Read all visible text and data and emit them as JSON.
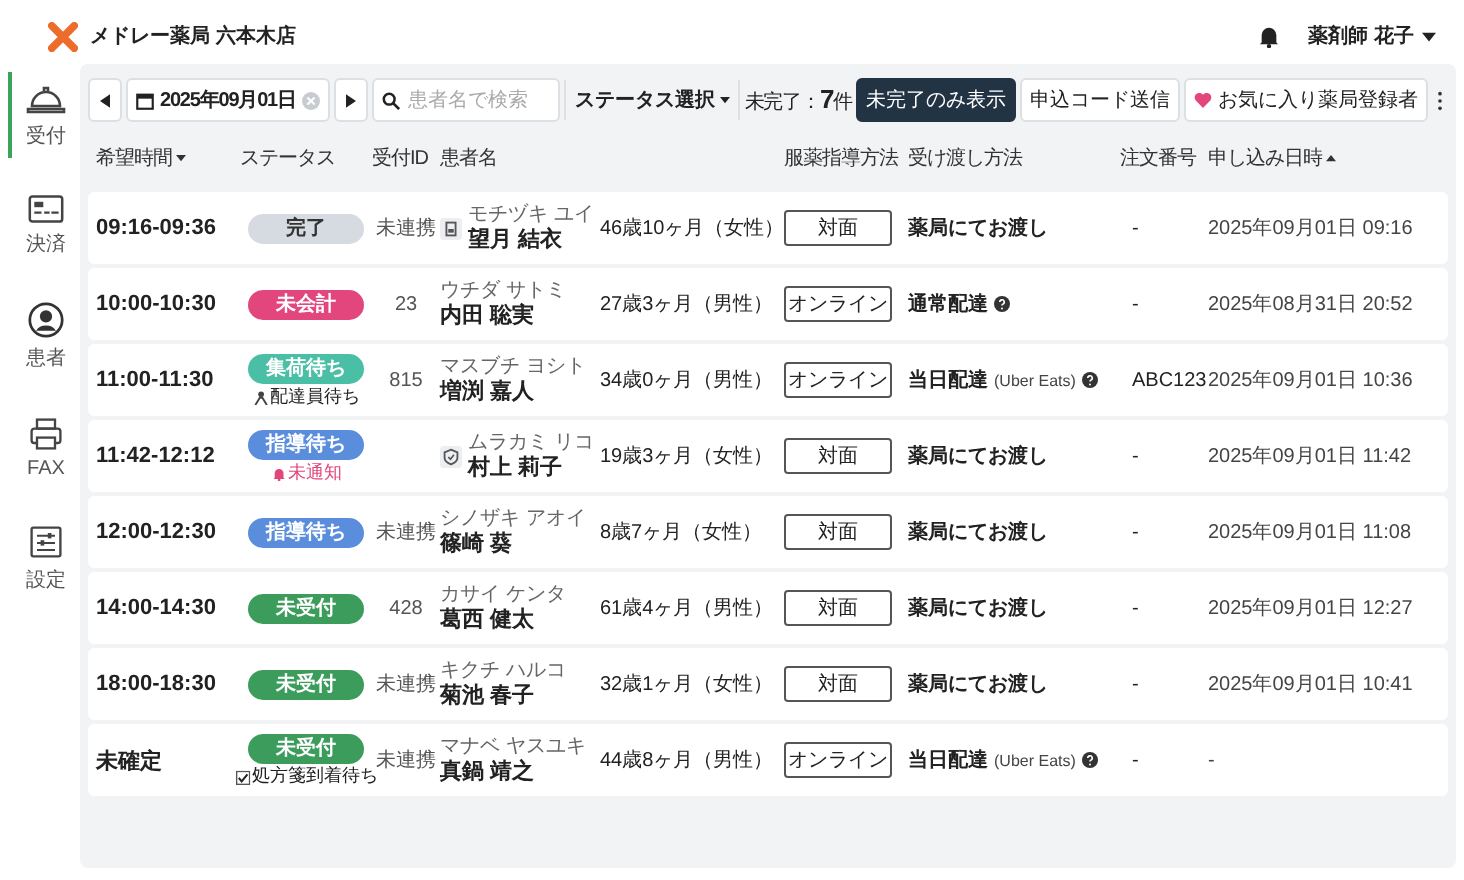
{
  "header": {
    "store_name": "メドレー薬局 六本木店",
    "user_name": "薬剤師 花子"
  },
  "sidebar": {
    "items": [
      {
        "label": "受付",
        "selected": true
      },
      {
        "label": "決済",
        "selected": false
      },
      {
        "label": "患者",
        "selected": false
      },
      {
        "label": "FAX",
        "selected": false
      },
      {
        "label": "設定",
        "selected": false
      }
    ]
  },
  "toolbar": {
    "date": "2025年09月01日",
    "search": {
      "placeholder": "患者名で検索"
    },
    "status_filter": "ステータス選択",
    "count_label": "未完了：",
    "count_value": "7",
    "count_unit": "件",
    "filter_button": "未完了のみ表示",
    "code_button": "申込コード送信",
    "favorite_button": "お気に入り薬局登録者"
  },
  "table": {
    "columns": [
      {
        "label": "希望時間",
        "sorted": true,
        "descending": true
      },
      {
        "label": "ステータス",
        "sorted": false
      },
      {
        "label": "受付ID",
        "sorted": false
      },
      {
        "label": "患者名",
        "sorted": false
      },
      {
        "label": "服薬指導方法",
        "sorted": false
      },
      {
        "label": "受け渡し方法",
        "sorted": false
      },
      {
        "label": "注文番号",
        "sorted": false
      },
      {
        "label": "申し込み日時",
        "sorted": true,
        "descending": false
      }
    ],
    "rows": [
      {
        "time": "09:16-09:36",
        "status": {
          "label": "完了",
          "kind": "done"
        },
        "reception_id": "未連携",
        "patient": {
          "kind": "card",
          "kana": "モチヅキ ユイ",
          "name": "望月 結衣",
          "age": "46歳10ヶ月（女性）"
        },
        "guidance": "対面",
        "delivery": {
          "method": "薬局にてお渡し"
        },
        "order_no": "-",
        "applied_at": "2025年09月01日 09:16"
      },
      {
        "time": "10:00-10:30",
        "status": {
          "label": "未会計",
          "kind": "unpaid"
        },
        "reception_id": "23",
        "patient": {
          "kana": "ウチダ サトミ",
          "name": "内田 聡実",
          "age": "27歳3ヶ月（男性）"
        },
        "guidance": "オンライン",
        "delivery": {
          "method": "通常配達",
          "help": true
        },
        "order_no": "-",
        "applied_at": "2025年08月31日 20:52"
      },
      {
        "time": "11:00-11:30",
        "status": {
          "label": "集荷待ち",
          "kind": "pickup",
          "note": {
            "kind": "courier",
            "text": "配達員待ち"
          }
        },
        "reception_id": "815",
        "patient": {
          "kana": "マスブチ ヨシト",
          "name": "増渕 嘉人",
          "age": "34歳0ヶ月（男性）"
        },
        "guidance": "オンライン",
        "delivery": {
          "method": "当日配達",
          "detail": "(Uber Eats)",
          "help": true
        },
        "order_no": "ABC123",
        "applied_at": "2025年09月01日 10:36"
      },
      {
        "time": "11:42-12:12",
        "status": {
          "label": "指導待ち",
          "kind": "guidance",
          "note": {
            "kind": "alert",
            "text": "未通知"
          }
        },
        "patient": {
          "kind": "verified",
          "kana": "ムラカミ リコ",
          "name": "村上 莉子",
          "age": "19歳3ヶ月（女性）"
        },
        "guidance": "対面",
        "delivery": {
          "method": "薬局にてお渡し"
        },
        "order_no": "-",
        "applied_at": "2025年09月01日 11:42"
      },
      {
        "time": "12:00-12:30",
        "status": {
          "label": "指導待ち",
          "kind": "guidance"
        },
        "reception_id": "未連携",
        "patient": {
          "kana": "シノザキ アオイ",
          "name": "篠崎 葵",
          "age": "8歳7ヶ月（女性）"
        },
        "guidance": "対面",
        "delivery": {
          "method": "薬局にてお渡し"
        },
        "order_no": "-",
        "applied_at": "2025年09月01日 11:08"
      },
      {
        "time": "14:00-14:30",
        "status": {
          "label": "未受付",
          "kind": "unaccepted"
        },
        "reception_id": "428",
        "patient": {
          "kana": "カサイ ケンタ",
          "name": "葛西 健太",
          "age": "61歳4ヶ月（男性）"
        },
        "guidance": "対面",
        "delivery": {
          "method": "薬局にてお渡し"
        },
        "order_no": "-",
        "applied_at": "2025年09月01日 12:27"
      },
      {
        "time": "18:00-18:30",
        "status": {
          "label": "未受付",
          "kind": "unaccepted"
        },
        "reception_id": "未連携",
        "patient": {
          "kana": "キクチ ハルコ",
          "name": "菊池 春子",
          "age": "32歳1ヶ月（女性）"
        },
        "guidance": "対面",
        "delivery": {
          "method": "薬局にてお渡し"
        },
        "order_no": "-",
        "applied_at": "2025年09月01日 10:41"
      },
      {
        "time": "未確定",
        "status": {
          "label": "未受付",
          "kind": "unaccepted",
          "note": {
            "kind": "checkbox",
            "text": "処方箋到着待ち",
            "checked": true
          }
        },
        "reception_id": "未連携",
        "patient": {
          "kana": "マナベ ヤスユキ",
          "name": "真鍋 靖之",
          "age": "44歳8ヶ月（男性）"
        },
        "guidance": "オンライン",
        "delivery": {
          "method": "当日配達",
          "detail": "(Uber Eats)",
          "help": true
        },
        "order_no": "-",
        "applied_at": "-"
      }
    ]
  }
}
